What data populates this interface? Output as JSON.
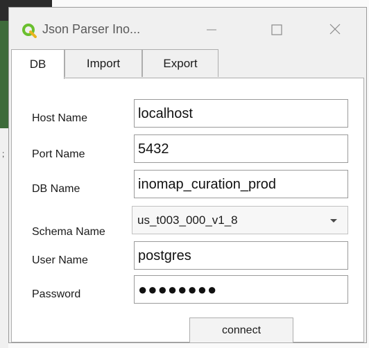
{
  "window": {
    "title": "Json Parser Ino...",
    "app_icon": "qgis-icon",
    "controls": [
      "minimize-icon",
      "maximize-icon",
      "close-icon"
    ]
  },
  "tabs": [
    {
      "label": "DB",
      "active": true
    },
    {
      "label": "Import",
      "active": false
    },
    {
      "label": "Export",
      "active": false
    }
  ],
  "form": {
    "host": {
      "label": "Host Name",
      "value": "localhost"
    },
    "port": {
      "label": "Port Name",
      "value": "5432"
    },
    "db": {
      "label": "DB Name",
      "value": "inomap_curation_prod"
    },
    "schema": {
      "label": "Schema Name",
      "value": "us_t003_000_v1_8"
    },
    "user": {
      "label": "User Name",
      "value": "postgres"
    },
    "password": {
      "label": "Password",
      "value": "●●●●●●●●"
    }
  },
  "actions": {
    "connect_label": "connect"
  },
  "colors": {
    "logo_green": "#6abf2e",
    "window_bg": "#f0f0f0",
    "panel_bg": "#ffffff",
    "border": "#adadad"
  }
}
